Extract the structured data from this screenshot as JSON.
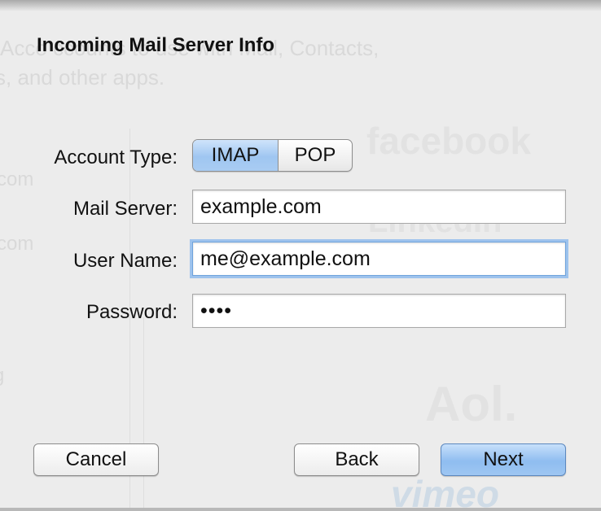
{
  "background": {
    "intro_line1": "Acco                    ccounts to use with Mail, Contacts,",
    "intro_line2": "s, and other apps.",
    "left_item1": "com",
    "left_item2": "com",
    "left_item3": "g",
    "brands": [
      "facebook",
      "LinkedIn",
      "Aol.",
      "vimeo"
    ]
  },
  "sheet": {
    "title": "Incoming Mail Server Info",
    "account_type": {
      "label": "Account Type:",
      "options": [
        "IMAP",
        "POP"
      ],
      "selected": "IMAP"
    },
    "mail_server": {
      "label": "Mail Server:",
      "value": "example.com"
    },
    "user_name": {
      "label": "User Name:",
      "value": "me@example.com"
    },
    "password": {
      "label": "Password:",
      "value": "••••"
    },
    "buttons": {
      "cancel": "Cancel",
      "back": "Back",
      "next": "Next"
    }
  },
  "colors": {
    "accent": "#9fc6f1",
    "focus_ring": "#9ec3ed"
  }
}
